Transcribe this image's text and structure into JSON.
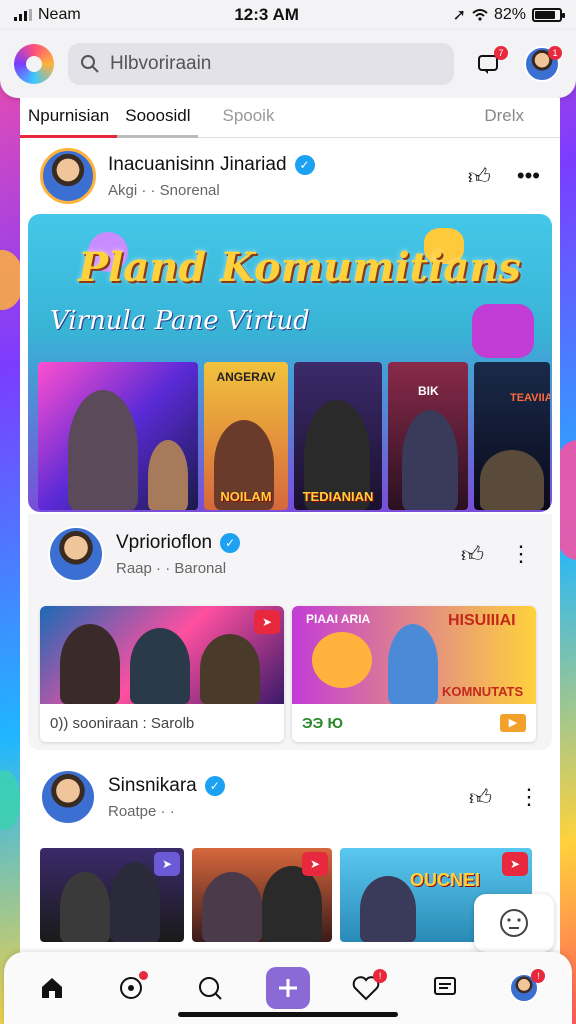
{
  "status": {
    "carrier": "Neam",
    "time": "12:3 AM",
    "battery": "82%",
    "battery_level": 0.82
  },
  "appbar": {
    "search_value": "Hlbvoriraain",
    "notif_badge": "7",
    "avatar_badge": "1"
  },
  "tabs": [
    {
      "label": "Npurnisian"
    },
    {
      "label": "Sooosidl"
    },
    {
      "label": "Spooik"
    },
    {
      "label": "Drelx"
    }
  ],
  "post1": {
    "name": "Inacuanisinn Jinariad",
    "meta": "Akgi · ·  Snorenal",
    "banner_title": "Pland Komumitians",
    "banner_sub": "Virnula Pane Virtud",
    "thumb_captions": [
      "ANGERAV",
      "NOILAM",
      "TEDIANIAN",
      "BIK",
      "TEAVIIA"
    ]
  },
  "post2": {
    "name": "Vpriorioflon",
    "meta": "Raap · ·  Baronal",
    "tiles": [
      {
        "caption": "0)) sooniraan : Sarolb"
      },
      {
        "caption": "ЭЭ Ю",
        "headline": "HISUIIIAI",
        "sub": "KOMNUTATS",
        "tag": "PIAAI ARIA"
      }
    ]
  },
  "post3": {
    "name": "Sinsnikara",
    "meta": "Roatpe · ·",
    "tile3_text": "OUCNEI"
  },
  "colors": {
    "accent": "#e8283c",
    "verified": "#1da1f2",
    "plus": "#8a6bd6"
  },
  "icons": [
    "signal-icon",
    "wifi-icon",
    "battery-icon",
    "search-icon",
    "notification-icon",
    "like-icon",
    "more-icon",
    "home-icon",
    "discover-icon",
    "search-nav-icon",
    "plus-icon",
    "heart-icon",
    "chat-icon",
    "emoji-icon"
  ]
}
